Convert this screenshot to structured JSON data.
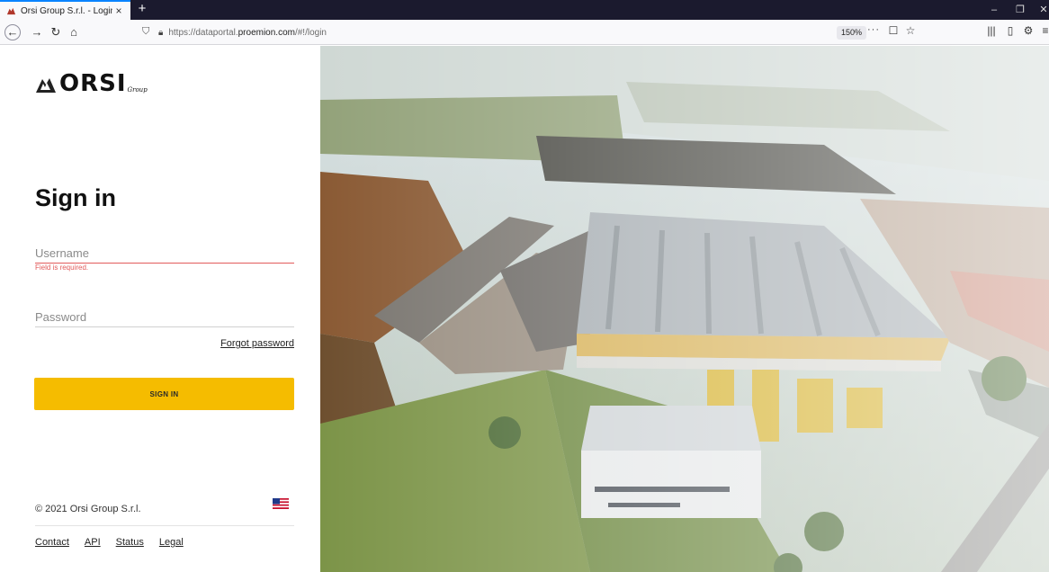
{
  "browser": {
    "tab_title": "Orsi Group S.r.l. - Login",
    "tab_close": "×",
    "new_tab": "+",
    "url_prefix": "https://dataportal.",
    "url_domain": "proemion.com",
    "url_path": "/#!/login",
    "zoom": "150%",
    "page_menu": "···",
    "window_controls": {
      "minimize": "–",
      "restore": "❐",
      "close": "✕"
    }
  },
  "brand": {
    "name": "ORSI",
    "suffix": "Group"
  },
  "form": {
    "title": "Sign in",
    "username_placeholder": "Username",
    "username_error": "Field is required.",
    "password_placeholder": "Password",
    "forgot_label": "Forgot password",
    "submit_label": "SIGN IN"
  },
  "footer": {
    "copyright": "© 2021 Orsi Group S.r.l.",
    "links": [
      "Contact",
      "API",
      "Status",
      "Legal"
    ]
  },
  "colors": {
    "accent": "#f5bc00",
    "error": "#e25b5b",
    "tabstrip": "#1b1a2e"
  },
  "icons": [
    "orsi-logo-icon",
    "close-icon",
    "plus-icon",
    "back-icon",
    "forward-icon",
    "reload-icon",
    "home-icon",
    "shield-icon",
    "lock-icon",
    "pocket-icon",
    "star-icon",
    "library-icon",
    "sidebar-icon",
    "extension-icon",
    "menu-icon",
    "us-flag-icon"
  ]
}
